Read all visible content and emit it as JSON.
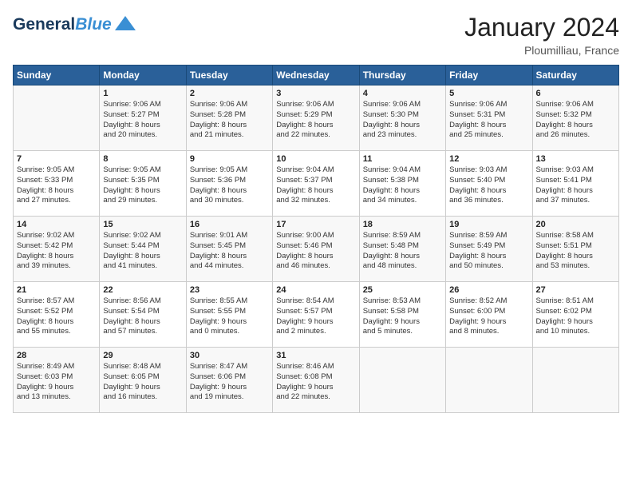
{
  "header": {
    "logo_line1": "General",
    "logo_line2": "Blue",
    "month": "January 2024",
    "location": "Ploumilliau, France"
  },
  "weekdays": [
    "Sunday",
    "Monday",
    "Tuesday",
    "Wednesday",
    "Thursday",
    "Friday",
    "Saturday"
  ],
  "weeks": [
    [
      {
        "day": "",
        "info": ""
      },
      {
        "day": "1",
        "info": "Sunrise: 9:06 AM\nSunset: 5:27 PM\nDaylight: 8 hours\nand 20 minutes."
      },
      {
        "day": "2",
        "info": "Sunrise: 9:06 AM\nSunset: 5:28 PM\nDaylight: 8 hours\nand 21 minutes."
      },
      {
        "day": "3",
        "info": "Sunrise: 9:06 AM\nSunset: 5:29 PM\nDaylight: 8 hours\nand 22 minutes."
      },
      {
        "day": "4",
        "info": "Sunrise: 9:06 AM\nSunset: 5:30 PM\nDaylight: 8 hours\nand 23 minutes."
      },
      {
        "day": "5",
        "info": "Sunrise: 9:06 AM\nSunset: 5:31 PM\nDaylight: 8 hours\nand 25 minutes."
      },
      {
        "day": "6",
        "info": "Sunrise: 9:06 AM\nSunset: 5:32 PM\nDaylight: 8 hours\nand 26 minutes."
      }
    ],
    [
      {
        "day": "7",
        "info": "Sunrise: 9:05 AM\nSunset: 5:33 PM\nDaylight: 8 hours\nand 27 minutes."
      },
      {
        "day": "8",
        "info": "Sunrise: 9:05 AM\nSunset: 5:35 PM\nDaylight: 8 hours\nand 29 minutes."
      },
      {
        "day": "9",
        "info": "Sunrise: 9:05 AM\nSunset: 5:36 PM\nDaylight: 8 hours\nand 30 minutes."
      },
      {
        "day": "10",
        "info": "Sunrise: 9:04 AM\nSunset: 5:37 PM\nDaylight: 8 hours\nand 32 minutes."
      },
      {
        "day": "11",
        "info": "Sunrise: 9:04 AM\nSunset: 5:38 PM\nDaylight: 8 hours\nand 34 minutes."
      },
      {
        "day": "12",
        "info": "Sunrise: 9:03 AM\nSunset: 5:40 PM\nDaylight: 8 hours\nand 36 minutes."
      },
      {
        "day": "13",
        "info": "Sunrise: 9:03 AM\nSunset: 5:41 PM\nDaylight: 8 hours\nand 37 minutes."
      }
    ],
    [
      {
        "day": "14",
        "info": "Sunrise: 9:02 AM\nSunset: 5:42 PM\nDaylight: 8 hours\nand 39 minutes."
      },
      {
        "day": "15",
        "info": "Sunrise: 9:02 AM\nSunset: 5:44 PM\nDaylight: 8 hours\nand 41 minutes."
      },
      {
        "day": "16",
        "info": "Sunrise: 9:01 AM\nSunset: 5:45 PM\nDaylight: 8 hours\nand 44 minutes."
      },
      {
        "day": "17",
        "info": "Sunrise: 9:00 AM\nSunset: 5:46 PM\nDaylight: 8 hours\nand 46 minutes."
      },
      {
        "day": "18",
        "info": "Sunrise: 8:59 AM\nSunset: 5:48 PM\nDaylight: 8 hours\nand 48 minutes."
      },
      {
        "day": "19",
        "info": "Sunrise: 8:59 AM\nSunset: 5:49 PM\nDaylight: 8 hours\nand 50 minutes."
      },
      {
        "day": "20",
        "info": "Sunrise: 8:58 AM\nSunset: 5:51 PM\nDaylight: 8 hours\nand 53 minutes."
      }
    ],
    [
      {
        "day": "21",
        "info": "Sunrise: 8:57 AM\nSunset: 5:52 PM\nDaylight: 8 hours\nand 55 minutes."
      },
      {
        "day": "22",
        "info": "Sunrise: 8:56 AM\nSunset: 5:54 PM\nDaylight: 8 hours\nand 57 minutes."
      },
      {
        "day": "23",
        "info": "Sunrise: 8:55 AM\nSunset: 5:55 PM\nDaylight: 9 hours\nand 0 minutes."
      },
      {
        "day": "24",
        "info": "Sunrise: 8:54 AM\nSunset: 5:57 PM\nDaylight: 9 hours\nand 2 minutes."
      },
      {
        "day": "25",
        "info": "Sunrise: 8:53 AM\nSunset: 5:58 PM\nDaylight: 9 hours\nand 5 minutes."
      },
      {
        "day": "26",
        "info": "Sunrise: 8:52 AM\nSunset: 6:00 PM\nDaylight: 9 hours\nand 8 minutes."
      },
      {
        "day": "27",
        "info": "Sunrise: 8:51 AM\nSunset: 6:02 PM\nDaylight: 9 hours\nand 10 minutes."
      }
    ],
    [
      {
        "day": "28",
        "info": "Sunrise: 8:49 AM\nSunset: 6:03 PM\nDaylight: 9 hours\nand 13 minutes."
      },
      {
        "day": "29",
        "info": "Sunrise: 8:48 AM\nSunset: 6:05 PM\nDaylight: 9 hours\nand 16 minutes."
      },
      {
        "day": "30",
        "info": "Sunrise: 8:47 AM\nSunset: 6:06 PM\nDaylight: 9 hours\nand 19 minutes."
      },
      {
        "day": "31",
        "info": "Sunrise: 8:46 AM\nSunset: 6:08 PM\nDaylight: 9 hours\nand 22 minutes."
      },
      {
        "day": "",
        "info": ""
      },
      {
        "day": "",
        "info": ""
      },
      {
        "day": "",
        "info": ""
      }
    ]
  ]
}
